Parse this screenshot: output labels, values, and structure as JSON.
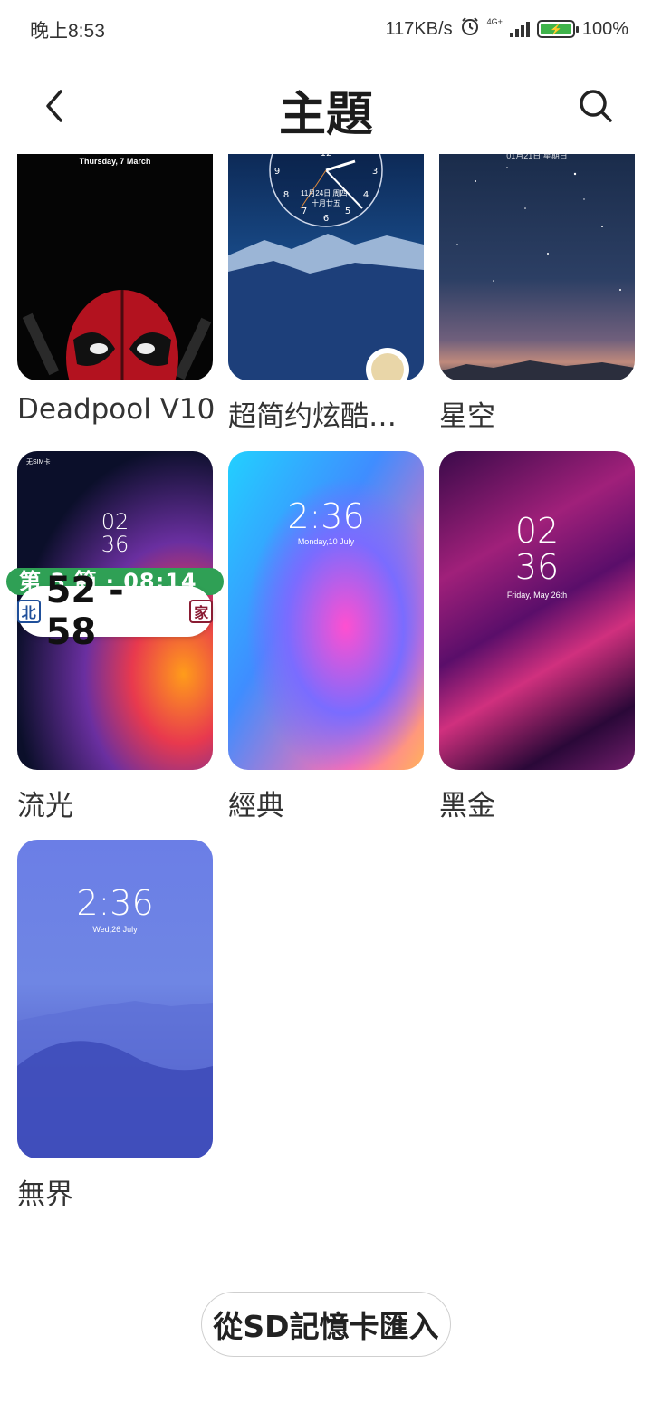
{
  "status_bar": {
    "time": "晚上8:53",
    "speed": "117KB/s",
    "network": "4G+",
    "battery": "100%",
    "battery_color": "#3fb34a"
  },
  "header": {
    "title": "主題",
    "back_icon": "chevron-left-icon",
    "search_icon": "search-icon"
  },
  "themes": [
    {
      "label": "Deadpool V10",
      "preview_text": "Thursday, 7 March"
    },
    {
      "label": "超简约炫酷…",
      "preview_text": "11月24日 周四",
      "preview_sub": "十月廿五"
    },
    {
      "label": "星空",
      "preview_text": "01月21日 星期日"
    },
    {
      "label": "流光",
      "preview_sim": "无SIM卡",
      "preview_clock": "02\n36"
    },
    {
      "label": "經典",
      "preview_clock": "2:36",
      "preview_text": "Monday,10 July"
    },
    {
      "label": "黑金",
      "preview_clock": "02\n36",
      "preview_text": "Friday, May 26th"
    },
    {
      "label": "無界",
      "preview_clock": "2:36",
      "preview_text": "Wed,26 July"
    }
  ],
  "score_overlay": {
    "period": "第 3 節 · 08:14",
    "score": "52 - 58",
    "home_color": "#1f4f9a",
    "away_color": "#8a1c33"
  },
  "import_button": "從SD記憶卡匯入"
}
